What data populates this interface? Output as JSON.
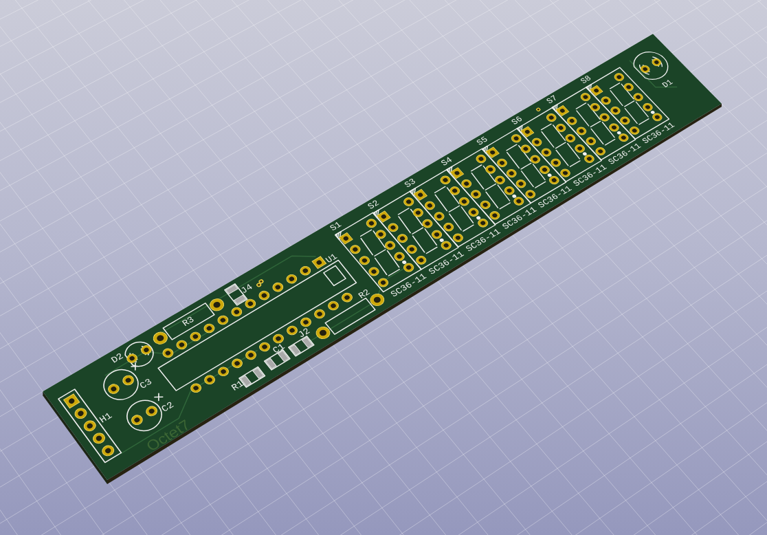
{
  "board": {
    "board_text": "Octet7",
    "components": [
      {
        "kind": "header",
        "ref": "H1"
      },
      {
        "kind": "capacitor",
        "ref": "C3"
      },
      {
        "kind": "capacitor",
        "ref": "C2"
      },
      {
        "kind": "led",
        "ref": "D2"
      },
      {
        "kind": "resistor",
        "ref": "R3"
      },
      {
        "kind": "smd",
        "ref": "J4"
      },
      {
        "kind": "dip",
        "ref": "U1"
      },
      {
        "kind": "smd",
        "ref": "R1"
      },
      {
        "kind": "smd",
        "ref": "C1"
      },
      {
        "kind": "smd",
        "ref": "J2"
      },
      {
        "kind": "resistor",
        "ref": "R2"
      },
      {
        "kind": "display",
        "ref": "S1",
        "part": "SC36-11"
      },
      {
        "kind": "display",
        "ref": "S2",
        "part": "SC36-11"
      },
      {
        "kind": "display",
        "ref": "S3",
        "part": "SC36-11"
      },
      {
        "kind": "display",
        "ref": "S4",
        "part": "SC36-11"
      },
      {
        "kind": "display",
        "ref": "S5",
        "part": "SC36-11"
      },
      {
        "kind": "display",
        "ref": "S6",
        "part": "SC36-11"
      },
      {
        "kind": "display",
        "ref": "S7",
        "part": "SC36-11"
      },
      {
        "kind": "display",
        "ref": "S8",
        "part": "SC36-11"
      },
      {
        "kind": "led",
        "ref": "D1"
      }
    ]
  }
}
